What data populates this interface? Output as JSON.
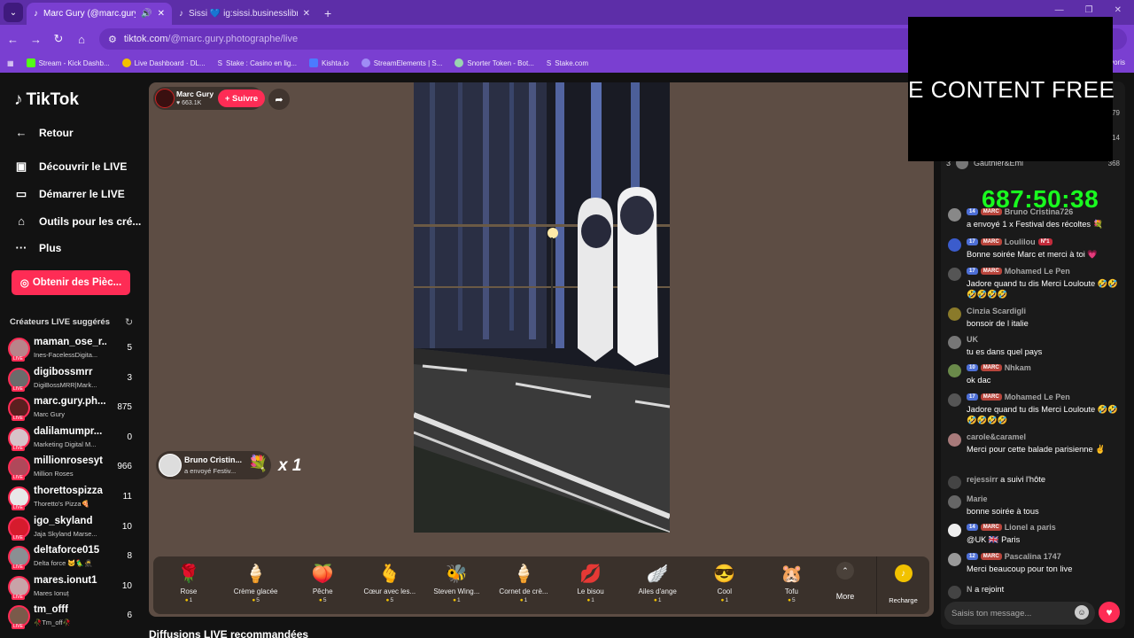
{
  "browser": {
    "tabs": [
      {
        "title": "Marc Gury (@marc.gury.ph",
        "active": true
      },
      {
        "title": "Sissi 💙 ig:sissi.businesslibre (@",
        "active": false
      }
    ],
    "url_host": "tiktok.com",
    "url_path": "/@marc.gury.photographe/live",
    "bookmarks": [
      {
        "label": "Stream - Kick Dashb...",
        "color": "#53fc18"
      },
      {
        "label": "Live Dashboard · DL...",
        "color": "#f2c200"
      },
      {
        "label": "Stake : Casino en lig...",
        "color": "#ffffff"
      },
      {
        "label": "Kishta.io",
        "color": "#4b7bff"
      },
      {
        "label": "StreamElements | S...",
        "color": "#9f8cf5"
      },
      {
        "label": "Snorter Token - Bot...",
        "color": "#9ad4b0"
      },
      {
        "label": "Stake.com",
        "color": "#ffffff"
      }
    ],
    "bookmarks_more": "voris"
  },
  "sidebar": {
    "logo": "TikTok",
    "back": "Retour",
    "nav": [
      {
        "label": "Découvrir le LIVE",
        "icon": "calendar-icon"
      },
      {
        "label": "Démarrer le LIVE",
        "icon": "camera-icon"
      },
      {
        "label": "Outils pour les cré...",
        "icon": "home-icon"
      },
      {
        "label": "Plus",
        "icon": "more-icon"
      }
    ],
    "coins_button": "Obtenir des Pièc...",
    "suggested_title": "Créateurs LIVE suggérés",
    "creators": [
      {
        "name": "maman_ose_r...",
        "sub": "Ines-FacelessDigita...",
        "count": "5",
        "color": "#b9848a"
      },
      {
        "name": "digibossmrr",
        "sub": "DigiBossMRR|Mark...",
        "count": "3",
        "color": "#6b6b6b"
      },
      {
        "name": "marc.gury.ph...",
        "sub": "Marc Gury",
        "count": "875",
        "color": "#5a1f1f"
      },
      {
        "name": "dalilamumpr...",
        "sub": "Marketing Digital M...",
        "count": "0",
        "color": "#d7c3c9"
      },
      {
        "name": "millionrosesyt",
        "sub": "Million Roses",
        "count": "966",
        "color": "#b0485a"
      },
      {
        "name": "thorettospizza",
        "sub": "Thoretto's Pizza🍕",
        "count": "11",
        "color": "#e8e8e8"
      },
      {
        "name": "igo_skyland",
        "sub": "Jaja Skyland Marse...",
        "count": "10",
        "color": "#d61b2d"
      },
      {
        "name": "deltaforce015",
        "sub": "Delta force 🐱🦜🥷",
        "count": "8",
        "color": "#8a8f93"
      },
      {
        "name": "mares.ionut1",
        "sub": "Mares Ionuț",
        "count": "10",
        "color": "#c8a3a8"
      },
      {
        "name": "tm_offf",
        "sub": "🥀Tm_off🥀",
        "count": "6",
        "color": "#7a5a4a"
      }
    ],
    "recommended_title": "Diffusions LIVE recommandées"
  },
  "player": {
    "host_name": "Marc Gury",
    "host_likes": "♥ 663.1K",
    "follow_label": "+ Suivre",
    "gift_toast": {
      "name": "Bruno Cristin...",
      "desc": "a envoyé Festiv...",
      "gift_icon": "bouquet-icon",
      "multiplier": "x 1"
    },
    "gifts": [
      {
        "name": "Rose",
        "price": "1",
        "icon": "🌹"
      },
      {
        "name": "Crème glacée",
        "price": "5",
        "icon": "🍦"
      },
      {
        "name": "Pêche",
        "price": "5",
        "icon": "🍑"
      },
      {
        "name": "Cœur avec les...",
        "price": "5",
        "icon": "🫰"
      },
      {
        "name": "Steven Wing...",
        "price": "1",
        "icon": "🐝"
      },
      {
        "name": "Cornet de crè...",
        "price": "1",
        "icon": "🍦"
      },
      {
        "name": "Le bisou",
        "price": "1",
        "icon": "💋"
      },
      {
        "name": "Ailes d'ange",
        "price": "1",
        "icon": "🪽"
      },
      {
        "name": "Cool",
        "price": "1",
        "icon": "😎"
      },
      {
        "name": "Tofu",
        "price": "5",
        "icon": "🐹"
      }
    ],
    "more_label": "More",
    "recharge_label": "Recharge"
  },
  "chat": {
    "ranking": [
      {
        "pos": "",
        "name": "",
        "value": "79"
      },
      {
        "pos": "",
        "name": "",
        "value": "14"
      },
      {
        "pos": "3",
        "name": "Gauthier&Emi",
        "value": "368"
      }
    ],
    "messages": [
      {
        "author": "Bruno Cristina726",
        "level": "14",
        "fan": "MARC",
        "text": "a envoyé 1 x Festival des récoltes 💐",
        "type": "gift"
      },
      {
        "author": "Loulilou",
        "level": "17",
        "fan": "MARC",
        "extra": "Nº1",
        "text": "Bonne soirée Marc et merci à toi 💗"
      },
      {
        "author": "Mohamed Le Pen",
        "level": "17",
        "fan": "MARC",
        "text": "Jadore quand tu dis Merci Louloute 🤣🤣🤣🤣🤣🤣"
      },
      {
        "author": "Cinzia Scardigli",
        "text": "bonsoir de l italie"
      },
      {
        "author": "UK",
        "text": "tu es dans quel pays"
      },
      {
        "author": "Nhkam",
        "level": "10",
        "fan": "MARC",
        "text": "ok dac"
      },
      {
        "author": "Mohamed Le Pen",
        "level": "17",
        "fan": "MARC",
        "text": "Jadore quand tu dis Merci Louloute 🤣🤣🤣🤣🤣🤣"
      },
      {
        "author": "carole&caramel",
        "text": "Merci pour cette balade parisienne ✌️"
      },
      {
        "author": "rejessirr",
        "text": "a suivi l'hôte",
        "type": "event"
      },
      {
        "author": "Marie",
        "text": "bonne soirée à tous"
      },
      {
        "author": "Lionel a paris",
        "level": "14",
        "fan": "MARC",
        "text": "@UK 🇬🇧 Paris"
      },
      {
        "author": "Pascalina 1747",
        "level": "12",
        "fan": "MARC",
        "text": "Merci beaucoup pour ton live"
      },
      {
        "author": "N",
        "text": "a rejoint",
        "type": "event"
      }
    ],
    "input_placeholder": "Saisis ton message..."
  },
  "overlay": {
    "promo_text": "E CONTENT  FREE",
    "timer": "687:50:38"
  }
}
